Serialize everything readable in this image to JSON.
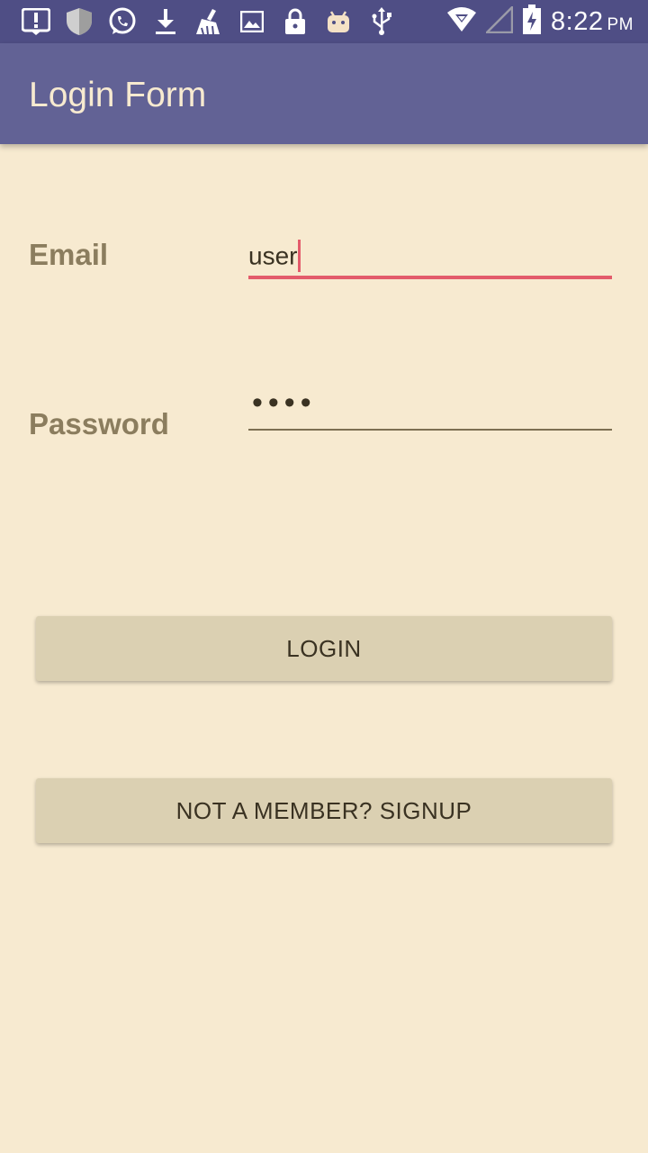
{
  "status_bar": {
    "icons": [
      "alert-icon",
      "shield-icon",
      "whatsapp-icon",
      "download-icon",
      "cleaner-icon",
      "image-icon",
      "lock-icon",
      "android-icon",
      "usb-icon"
    ],
    "time": "8:22",
    "ampm": "PM"
  },
  "app_bar": {
    "title": "Login Form"
  },
  "form": {
    "email_label": "Email",
    "email_value": "user",
    "password_label": "Password",
    "password_value": "••••"
  },
  "buttons": {
    "login": "LOGIN",
    "signup": "NOT A MEMBER? SIGNUP"
  },
  "colors": {
    "status_bar": "#4f4e85",
    "app_bar": "#626295",
    "background": "#f7ead0",
    "accent": "#e35b6b",
    "button": "#dbd0b2"
  }
}
